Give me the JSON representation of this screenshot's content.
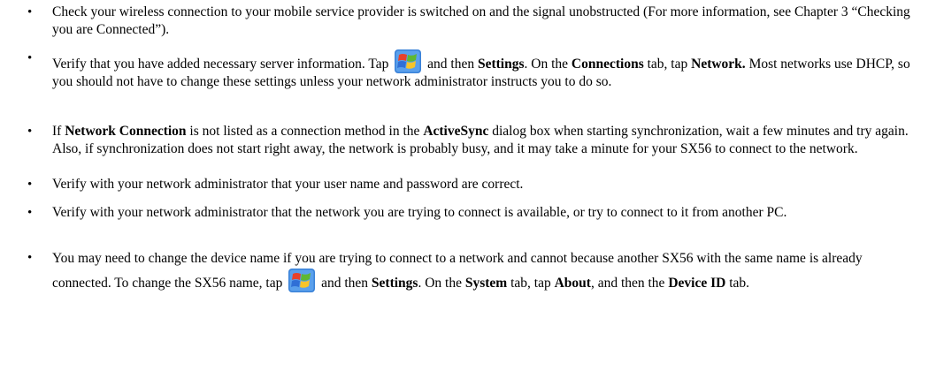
{
  "bullet_char": "•",
  "items": [
    {
      "p1": "Check your wireless connection to your mobile service provider is switched on and the signal unobstructed (For more information, see Chapter 3 “Checking you are Connected”)."
    },
    {
      "p1": "Verify that you have added necessary server information. Tap",
      "p2": "and then",
      "b1": "Settings",
      "p3": ". On the",
      "b2": "Connections",
      "p4": "tab, tap",
      "b3": "Network.",
      "p5": "Most networks use DHCP, so you should not have to change these settings unless your network administrator instructs you to do so."
    },
    {
      "p1": "If",
      "b1": "Network Connection",
      "p2": "is not listed as a connection method in the",
      "b2": "ActiveSync",
      "p3": "dialog box when starting synchronization, wait a few minutes and try again. Also, if synchronization does not start right away, the network is probably busy, and it may take a minute for your SX56 to connect to the network."
    },
    {
      "p1": "Verify with your network administrator that your user name and password are correct."
    },
    {
      "p1": "Verify with your network administrator that the network you are trying to connect is available, or try to connect to it from another PC."
    },
    {
      "p1": "You may need to change the device name if you are trying to connect to a network and cannot because another SX56 with the same name is already connected. To change the SX56 name, tap",
      "p2": "and then",
      "b1": "Settings",
      "p3": ". On the",
      "b2": "System",
      "p4": "tab, tap",
      "b3": "About",
      "p5": ", and then the",
      "b4": "Device ID",
      "p6": "tab."
    }
  ],
  "icons": {
    "start": "windows-start-flag-icon"
  },
  "colors": {
    "flag_red": "#e8412a",
    "flag_green": "#5fb832",
    "flag_blue": "#2f6fd6",
    "flag_yellow": "#f7c42a",
    "icon_bg": "#3a82d8"
  }
}
